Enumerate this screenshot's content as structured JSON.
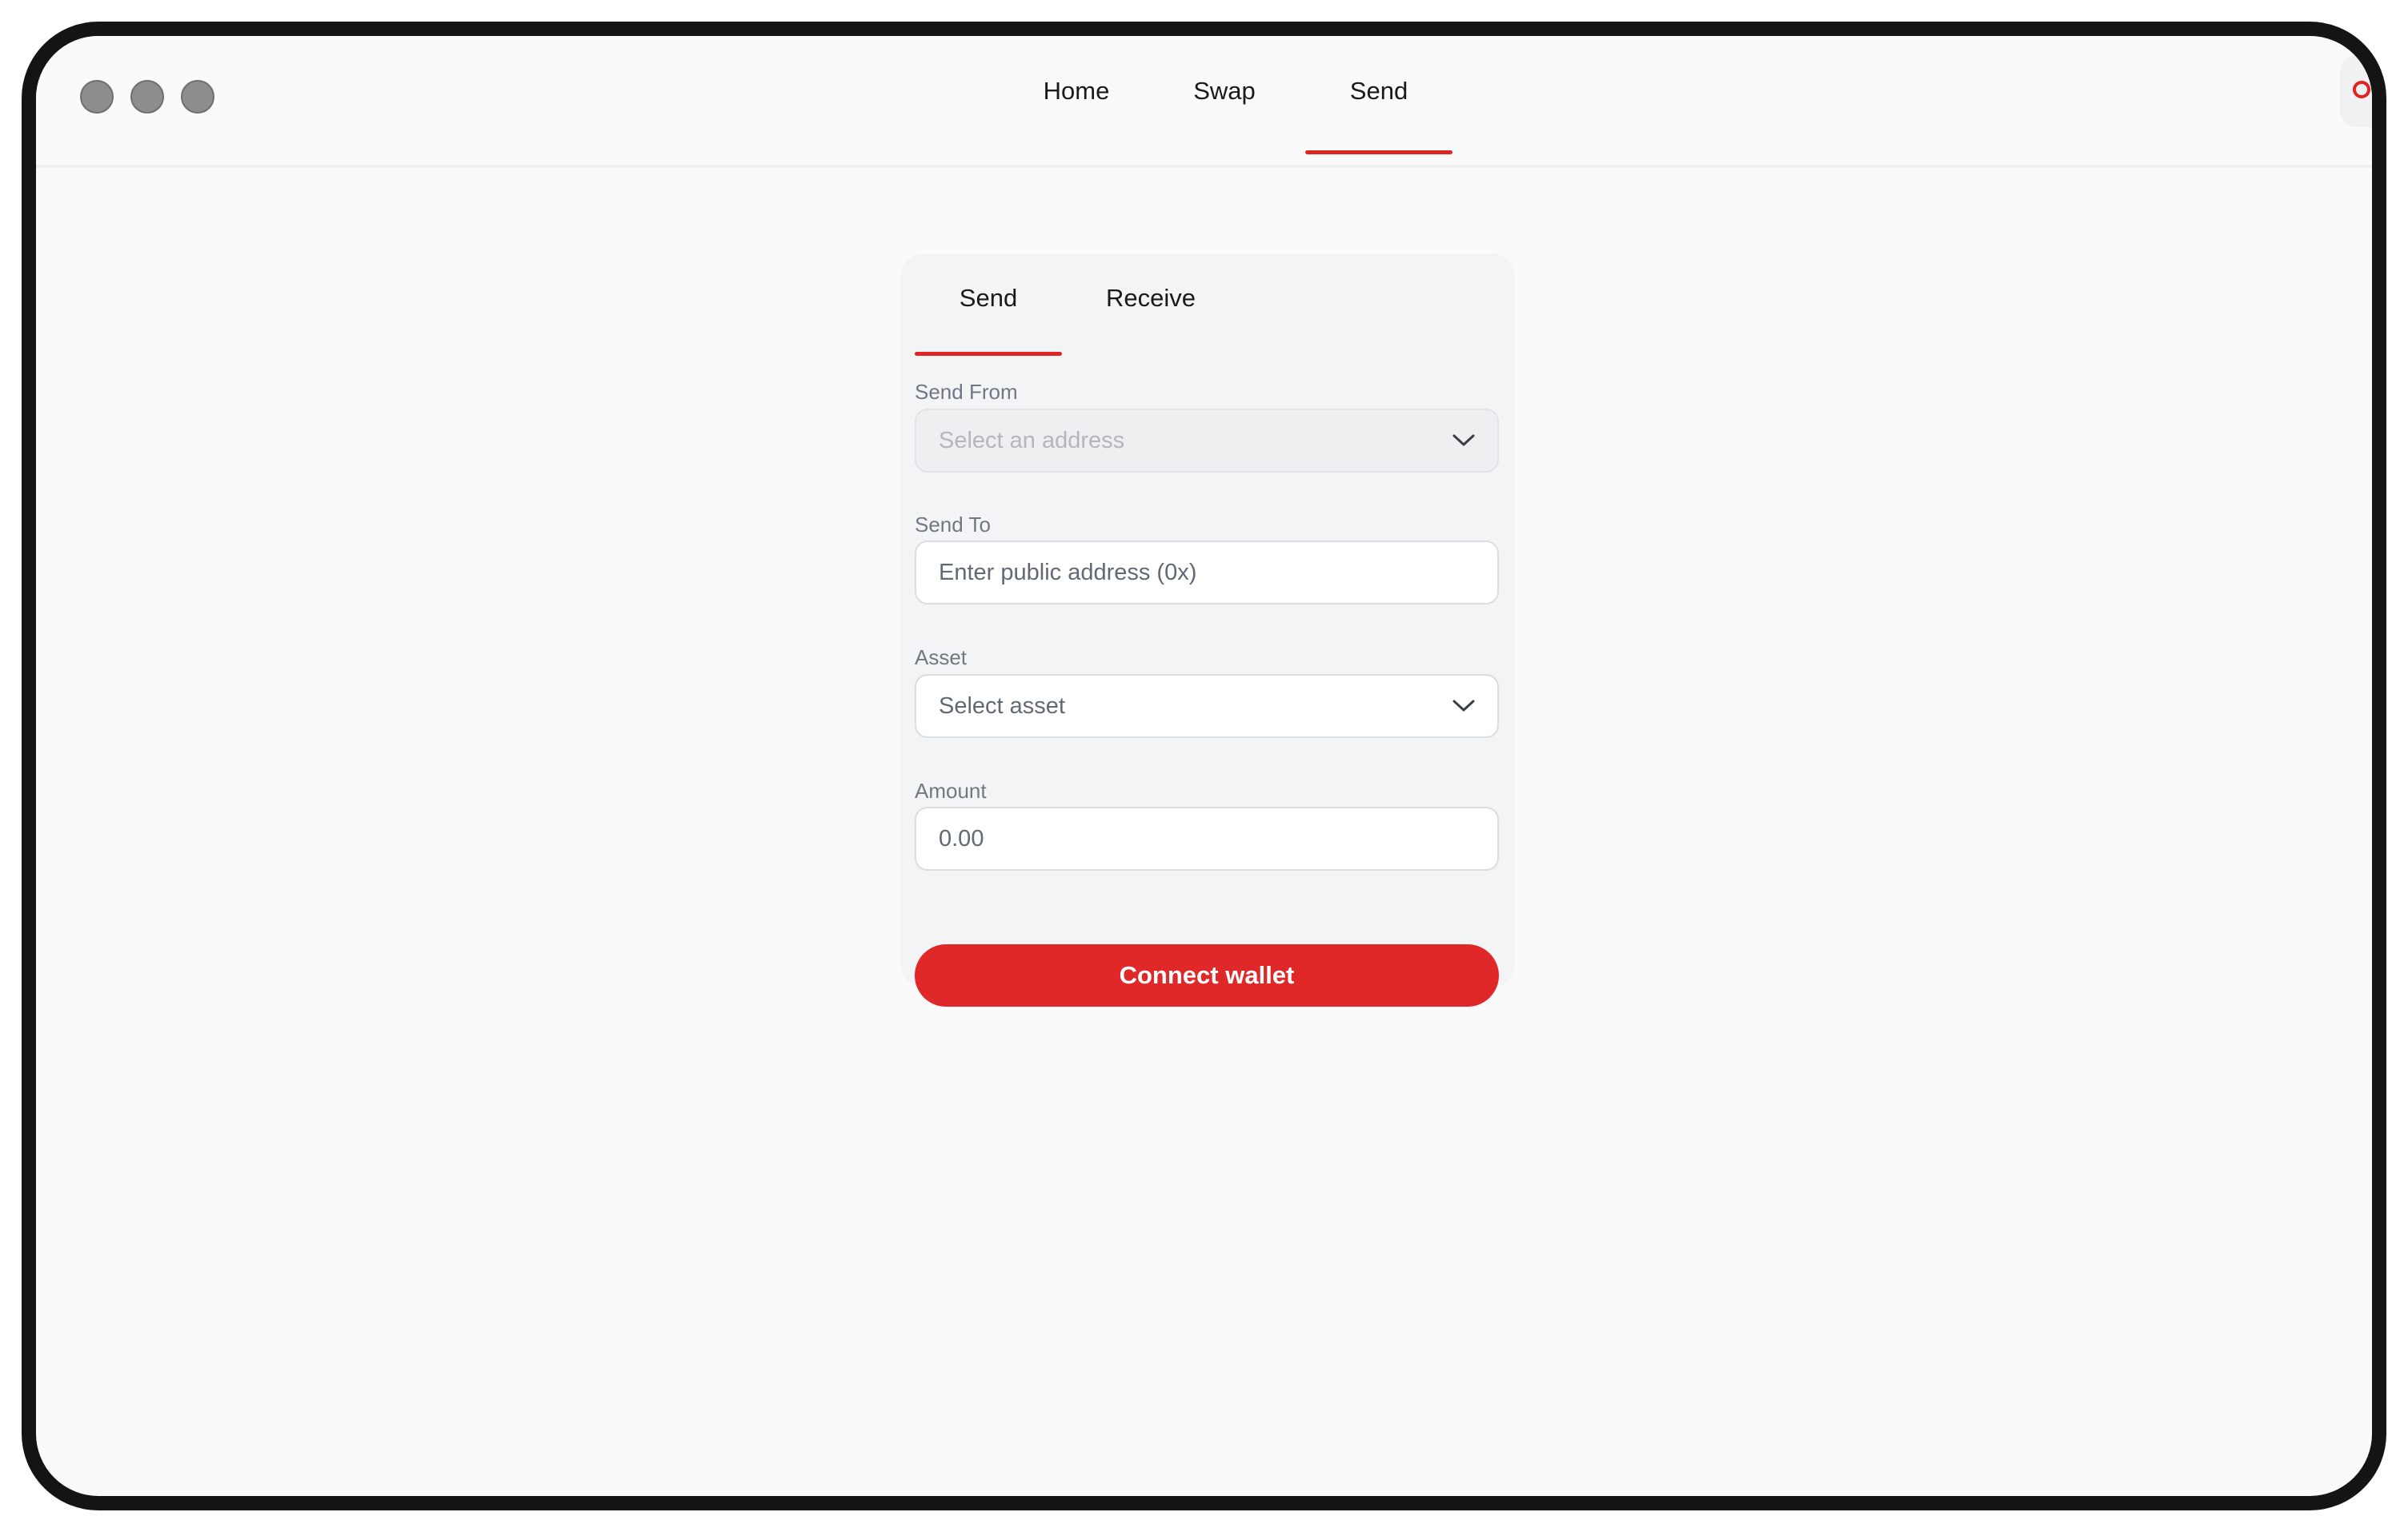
{
  "window": {
    "traffic_lights": [
      "close",
      "minimize",
      "maximize"
    ]
  },
  "nav": {
    "items": [
      {
        "label": "Home"
      },
      {
        "label": "Swap"
      },
      {
        "label": "Send"
      }
    ],
    "active": "Send"
  },
  "colors": {
    "accent": "#e02424",
    "button": "#e02828",
    "background": "#fafafa",
    "card": "#f3f4f6",
    "frame": "#141414"
  },
  "card": {
    "tabs": [
      {
        "label": "Send"
      },
      {
        "label": "Receive"
      }
    ],
    "active_tab": "Send",
    "send_from": {
      "label": "Send From",
      "placeholder": "Select an address",
      "icon": "chevron-down-icon"
    },
    "send_to": {
      "label": "Send To",
      "placeholder": "Enter public address (0x)"
    },
    "asset": {
      "label": "Asset",
      "placeholder": "Select asset",
      "icon": "chevron-down-icon"
    },
    "amount": {
      "label": "Amount",
      "placeholder": "0.00"
    },
    "button_label": "Connect wallet"
  }
}
